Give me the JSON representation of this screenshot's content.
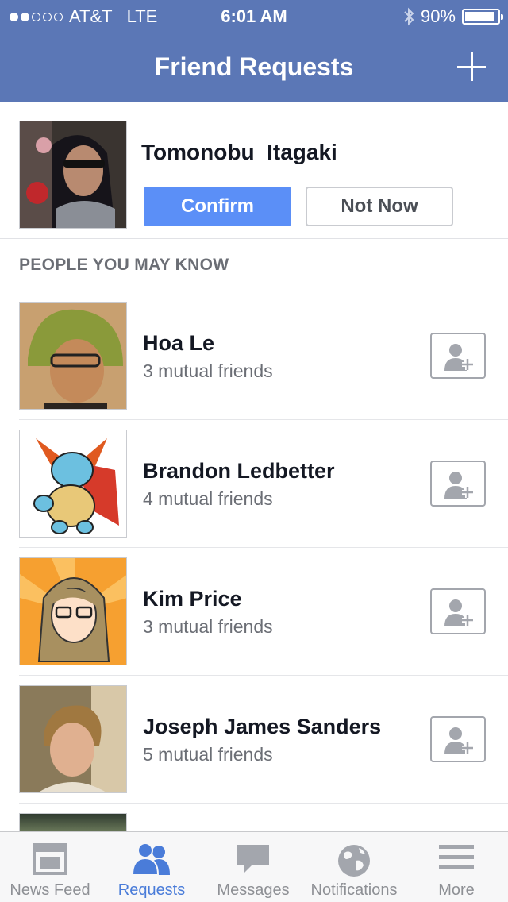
{
  "status_bar": {
    "carrier": "AT&T",
    "network": "LTE",
    "time": "6:01 AM",
    "battery": "90%",
    "battery_level": 0.9,
    "signal_bars": 2,
    "signal_total": 5
  },
  "header": {
    "title": "Friend Requests",
    "add_icon": "plus-icon"
  },
  "request": {
    "name": "Tomonobu  Itagaki",
    "confirm_label": "Confirm",
    "not_now_label": "Not Now"
  },
  "section": {
    "title": "PEOPLE YOU MAY KNOW"
  },
  "suggestions": [
    {
      "name": "Hoa Le",
      "mutual": "3 mutual friends"
    },
    {
      "name": "Brandon Ledbetter",
      "mutual": "4 mutual friends"
    },
    {
      "name": "Kim Price",
      "mutual": "3 mutual friends"
    },
    {
      "name": "Joseph James Sanders",
      "mutual": "5 mutual friends"
    }
  ],
  "tabs": [
    {
      "label": "News Feed",
      "icon": "news-feed-icon",
      "active": false
    },
    {
      "label": "Requests",
      "icon": "requests-icon",
      "active": true
    },
    {
      "label": "Messages",
      "icon": "messages-icon",
      "active": false
    },
    {
      "label": "Notifications",
      "icon": "globe-icon",
      "active": false
    },
    {
      "label": "More",
      "icon": "menu-icon",
      "active": false
    }
  ],
  "colors": {
    "header_bg": "#5b77b6",
    "confirm_bg": "#5b8ff7",
    "active_tab": "#4a7cd9"
  }
}
